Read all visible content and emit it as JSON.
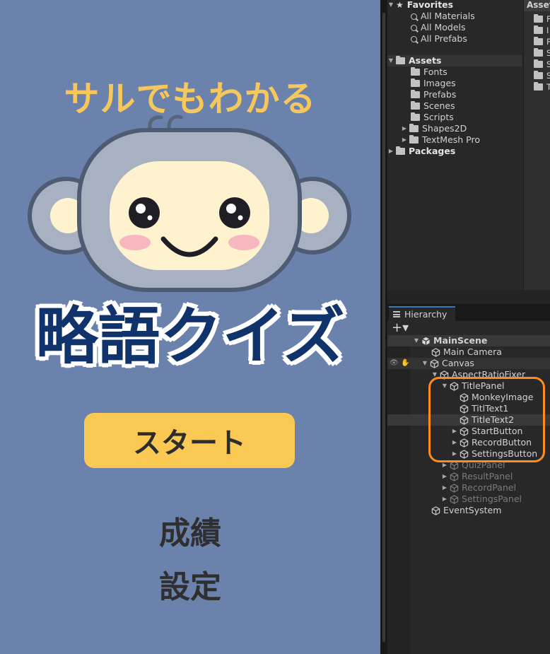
{
  "game": {
    "subtitle": "サルでもわかる",
    "title": "略語クイズ",
    "start_label": "スタート",
    "record_label": "成績",
    "settings_label": "設定",
    "colors": {
      "background": "#6b82ad",
      "subtitle": "#f6c75a",
      "title": "#10336b",
      "button": "#f9c954"
    }
  },
  "project": {
    "favorites": {
      "label": "Favorites",
      "items": [
        "All Materials",
        "All Models",
        "All Prefabs"
      ]
    },
    "assets": {
      "label": "Assets",
      "items": [
        "Fonts",
        "Images",
        "Prefabs",
        "Scenes",
        "Scripts",
        "Shapes2D",
        "TextMesh Pro"
      ]
    },
    "packages": {
      "label": "Packages"
    },
    "asset_header": "Assets",
    "asset_column_items": [
      "F",
      "I",
      "P",
      "S",
      "S",
      "S",
      "T"
    ]
  },
  "hierarchy": {
    "tab_label": "Hierarchy",
    "add_label": "+▾",
    "rows": [
      {
        "label": "MainScene"
      },
      {
        "label": "Main Camera"
      },
      {
        "label": "Canvas"
      },
      {
        "label": "AspectRatioFixer"
      },
      {
        "label": "TitlePanel"
      },
      {
        "label": "MonkeyImage"
      },
      {
        "label": "TitlText1"
      },
      {
        "label": "TitleText2"
      },
      {
        "label": "StartButton"
      },
      {
        "label": "RecordButton"
      },
      {
        "label": "SettingsButton"
      },
      {
        "label": "QuizPanel"
      },
      {
        "label": "ResultPanel"
      },
      {
        "label": "RecordPanel"
      },
      {
        "label": "SettingsPanel"
      },
      {
        "label": "EventSystem"
      }
    ],
    "highlight_color": "#ff8a1e"
  }
}
